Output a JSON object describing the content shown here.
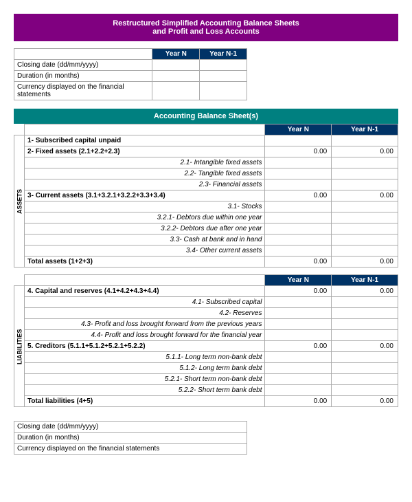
{
  "title": {
    "line1": "Restructured Simplified Accounting Balance Sheets",
    "line2": "and Profit and Loss Accounts"
  },
  "info_fields": {
    "closing_date": "Closing date (dd/mm/yyyy)",
    "duration": "Duration (in months)",
    "currency": "Currency displayed on the financial statements"
  },
  "column_headers": {
    "yearN": "Year N",
    "yearN1": "Year N-1"
  },
  "balance_sheet_title": "Accounting Balance Sheet(s)",
  "assets_label": "ASSETS",
  "liabilities_label": "LIABILITIES",
  "rows_assets": [
    {
      "label": "1- Subscribed capital unpaid",
      "bold": true,
      "indent": 0,
      "yearN": "",
      "yearN1": ""
    },
    {
      "label": "2- Fixed assets (2.1+2.2+2.3)",
      "bold": true,
      "indent": 0,
      "yearN": "0.00",
      "yearN1": "0.00"
    },
    {
      "label": "2.1- Intangible fixed assets",
      "bold": false,
      "indent": 2,
      "yearN": "",
      "yearN1": "",
      "italic": true
    },
    {
      "label": "2.2- Tangible fixed assets",
      "bold": false,
      "indent": 2,
      "yearN": "",
      "yearN1": "",
      "italic": true
    },
    {
      "label": "2.3- Financial assets",
      "bold": false,
      "indent": 2,
      "yearN": "",
      "yearN1": "",
      "italic": true
    },
    {
      "label": "3- Current assets (3.1+3.2.1+3.2.2+3.3+3.4)",
      "bold": true,
      "indent": 0,
      "yearN": "0.00",
      "yearN1": "0.00"
    },
    {
      "label": "3.1- Stocks",
      "bold": false,
      "indent": 2,
      "yearN": "",
      "yearN1": "",
      "italic": true
    },
    {
      "label": "3.2.1- Debtors due within one year",
      "bold": false,
      "indent": 2,
      "yearN": "",
      "yearN1": "",
      "italic": true
    },
    {
      "label": "3.2.2- Debtors due after one year",
      "bold": false,
      "indent": 2,
      "yearN": "",
      "yearN1": "",
      "italic": true
    },
    {
      "label": "3.3- Cash at bank and in hand",
      "bold": false,
      "indent": 2,
      "yearN": "",
      "yearN1": "",
      "italic": true
    },
    {
      "label": "3.4- Other current assets",
      "bold": false,
      "indent": 2,
      "yearN": "",
      "yearN1": "",
      "italic": true
    },
    {
      "label": "Total assets (1+2+3)",
      "bold": true,
      "indent": 0,
      "yearN": "0.00",
      "yearN1": "0.00"
    }
  ],
  "rows_liabilities": [
    {
      "label": "4. Capital and reserves (4.1+4.2+4.3+4.4)",
      "bold": true,
      "indent": 0,
      "yearN": "0.00",
      "yearN1": "0.00"
    },
    {
      "label": "4.1- Subscribed capital",
      "bold": false,
      "indent": 2,
      "yearN": "",
      "yearN1": "",
      "italic": true
    },
    {
      "label": "4.2- Reserves",
      "bold": false,
      "indent": 2,
      "yearN": "",
      "yearN1": "",
      "italic": true
    },
    {
      "label": "4.3- Profit and loss brought forward from the previous years",
      "bold": false,
      "indent": 2,
      "yearN": "",
      "yearN1": "",
      "italic": true
    },
    {
      "label": "4.4- Profit and loss brought forward for the financial year",
      "bold": false,
      "indent": 2,
      "yearN": "",
      "yearN1": "",
      "italic": true
    },
    {
      "label": "5. Creditors (5.1.1+5.1.2+5.2.1+5.2.2)",
      "bold": true,
      "indent": 0,
      "yearN": "0.00",
      "yearN1": "0.00"
    },
    {
      "label": "5.1.1- Long term non-bank debt",
      "bold": false,
      "indent": 2,
      "yearN": "",
      "yearN1": "",
      "italic": true
    },
    {
      "label": "5.1.2- Long term bank debt",
      "bold": false,
      "indent": 2,
      "yearN": "",
      "yearN1": "",
      "italic": true
    },
    {
      "label": "5.2.1- Short term non-bank debt",
      "bold": false,
      "indent": 2,
      "yearN": "",
      "yearN1": "",
      "italic": true
    },
    {
      "label": "5.2.2- Short term bank debt",
      "bold": false,
      "indent": 2,
      "yearN": "",
      "yearN1": "",
      "italic": true
    },
    {
      "label": "Total liabilities (4+5)",
      "bold": true,
      "indent": 0,
      "yearN": "0.00",
      "yearN1": "0.00"
    }
  ]
}
